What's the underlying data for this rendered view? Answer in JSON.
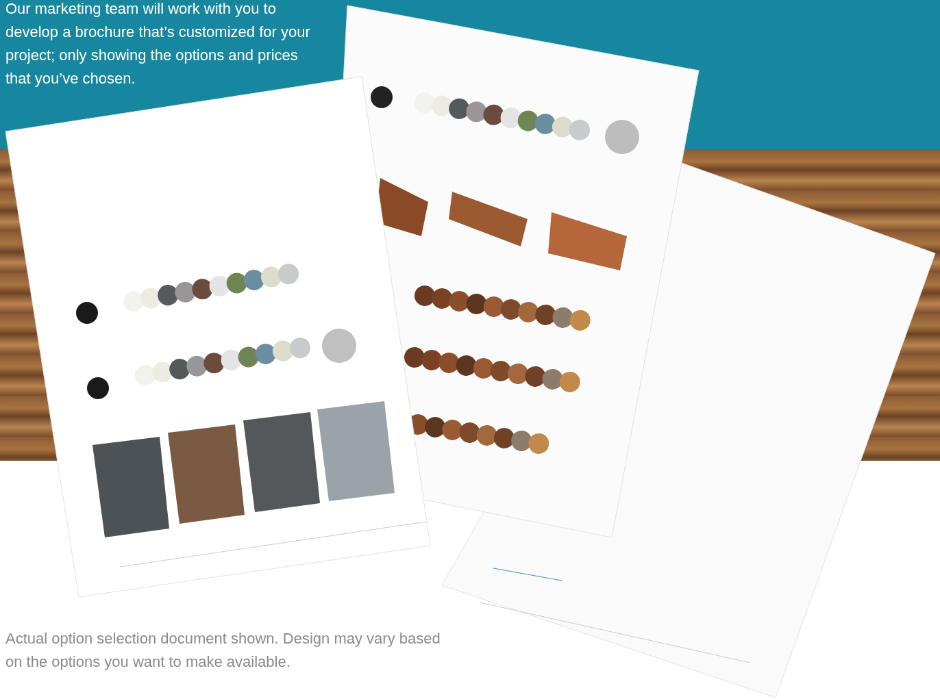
{
  "intro": {
    "text": "Our marketing team will work with you to develop a brochure that’s customized for your project; only showing the options and prices that you’ve chosen."
  },
  "caption": {
    "text": "Actual option selection document shown. Design may vary based on the options you want to make available."
  }
}
